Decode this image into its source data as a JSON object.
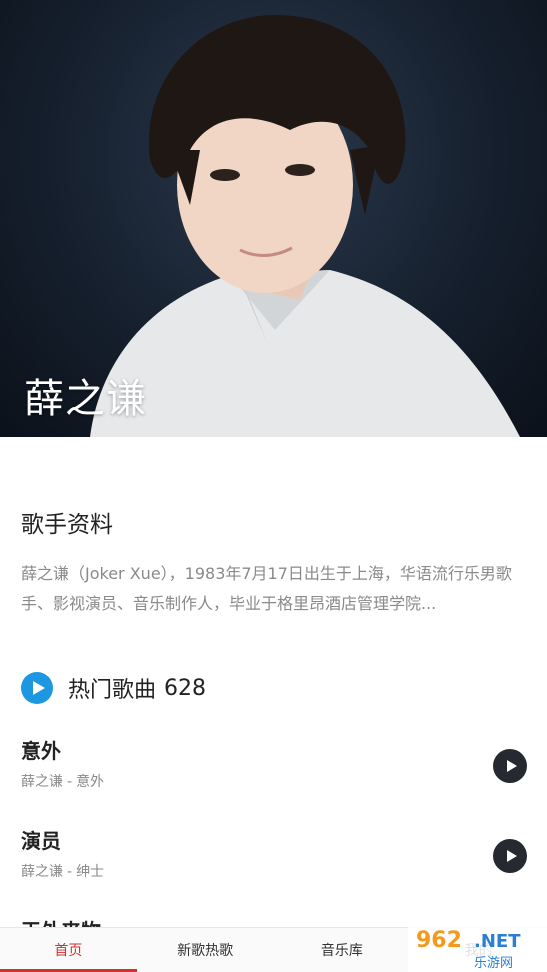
{
  "artist": {
    "name": "薛之谦"
  },
  "profile": {
    "title": "歌手资料",
    "bio": "薛之谦（Joker Xue），1983年7月17日出生于上海，华语流行乐男歌手、影视演员、音乐制作人，毕业于格里昂酒店管理学院..."
  },
  "hot_songs": {
    "title": "热门歌曲",
    "count": "628",
    "songs": [
      {
        "title": "意外",
        "artist": "薛之谦",
        "sep": "-",
        "album": "意外"
      },
      {
        "title": "演员",
        "artist": "薛之谦",
        "sep": "-",
        "album": "绅士"
      },
      {
        "title": "天外来物",
        "artist": "",
        "sep": "",
        "album": ""
      }
    ]
  },
  "nav": {
    "items": [
      {
        "label": "首页",
        "active": true
      },
      {
        "label": "新歌热歌",
        "active": false
      },
      {
        "label": "音乐库",
        "active": false
      },
      {
        "label": "我的",
        "active": false
      }
    ]
  },
  "watermark": {
    "brand": "962.NET",
    "subtitle": "乐游网"
  },
  "colors": {
    "accent_red": "#d0312d",
    "play_blue": "#1d97df",
    "play_dark": "#262a30"
  }
}
